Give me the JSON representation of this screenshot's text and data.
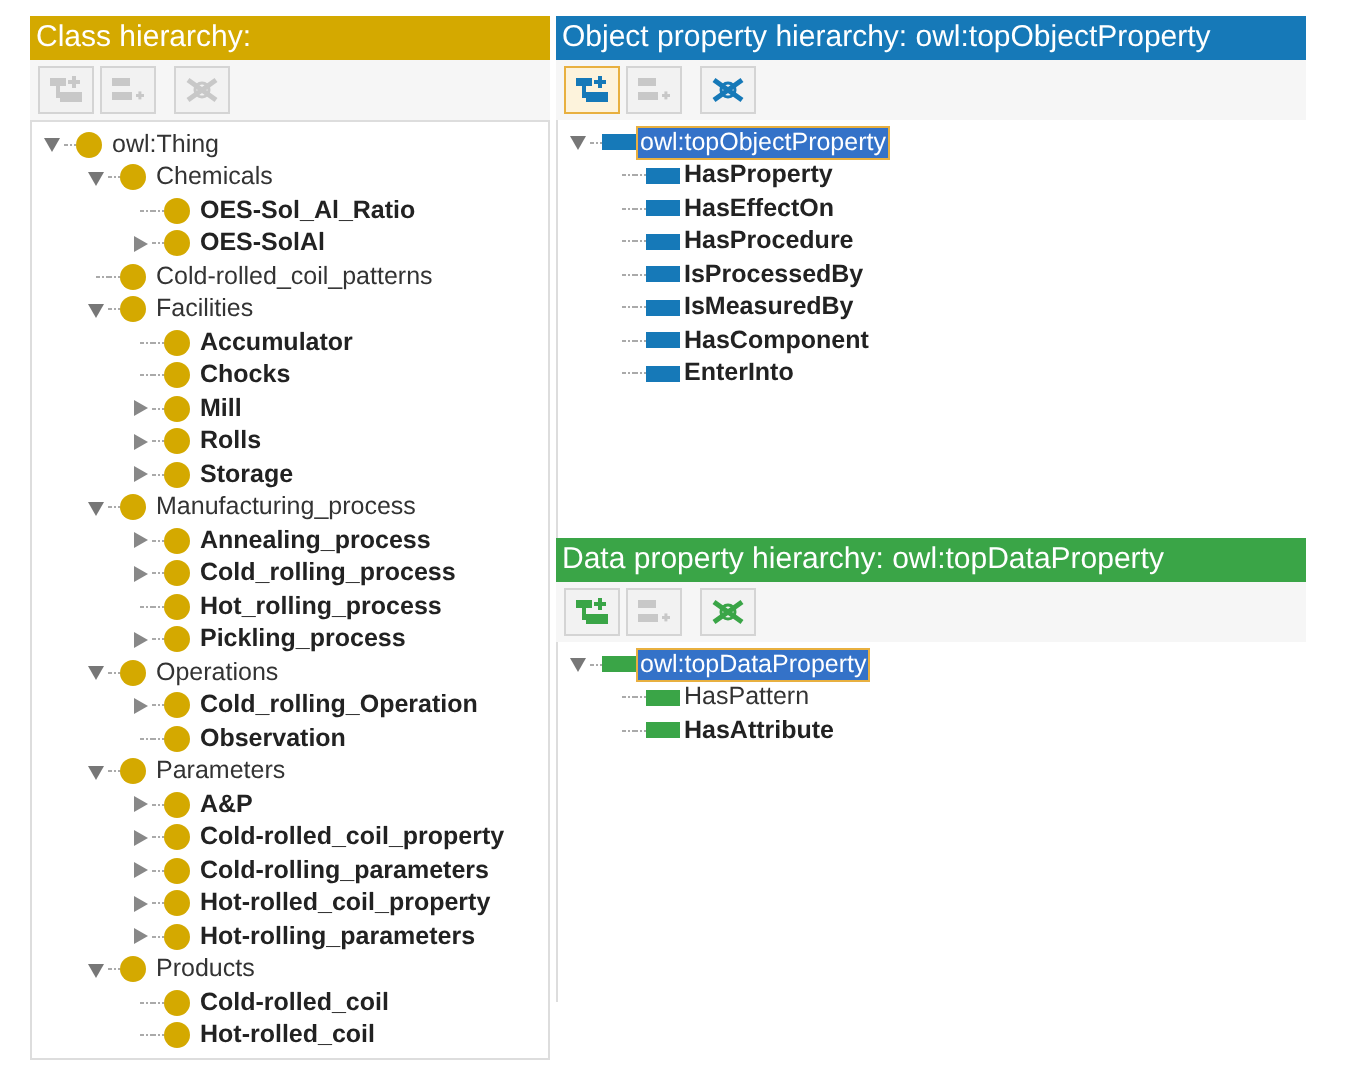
{
  "class_panel": {
    "title": "Class hierarchy:",
    "color": "#d4a900",
    "toolbar": [
      {
        "kind": "add-sub",
        "disabled": true,
        "selected": false
      },
      {
        "kind": "add-sibling",
        "disabled": true,
        "selected": false
      },
      {
        "kind": "delete",
        "disabled": true,
        "selected": false
      }
    ],
    "tree": [
      {
        "label": "owl:Thing",
        "bold": false,
        "selected": false,
        "kind": "branch",
        "expanded": true,
        "children": [
          {
            "label": "Chemicals",
            "bold": false,
            "selected": false,
            "kind": "branch",
            "expanded": true,
            "children": [
              {
                "label": "OES-Sol_Al_Ratio",
                "bold": true,
                "selected": false,
                "kind": "leaf"
              },
              {
                "label": "OES-SolAl",
                "bold": true,
                "selected": false,
                "kind": "branch",
                "expanded": false
              }
            ]
          },
          {
            "label": "Cold-rolled_coil_patterns",
            "bold": false,
            "selected": false,
            "kind": "leaf"
          },
          {
            "label": "Facilities",
            "bold": false,
            "selected": false,
            "kind": "branch",
            "expanded": true,
            "children": [
              {
                "label": "Accumulator",
                "bold": true,
                "selected": false,
                "kind": "leaf"
              },
              {
                "label": "Chocks",
                "bold": true,
                "selected": false,
                "kind": "leaf"
              },
              {
                "label": "Mill",
                "bold": true,
                "selected": false,
                "kind": "branch",
                "expanded": false
              },
              {
                "label": "Rolls",
                "bold": true,
                "selected": false,
                "kind": "branch",
                "expanded": false
              },
              {
                "label": "Storage",
                "bold": true,
                "selected": false,
                "kind": "branch",
                "expanded": false
              }
            ]
          },
          {
            "label": "Manufacturing_process",
            "bold": false,
            "selected": false,
            "kind": "branch",
            "expanded": true,
            "children": [
              {
                "label": "Annealing_process",
                "bold": true,
                "selected": false,
                "kind": "branch",
                "expanded": false
              },
              {
                "label": "Cold_rolling_process",
                "bold": true,
                "selected": false,
                "kind": "branch",
                "expanded": false
              },
              {
                "label": "Hot_rolling_process",
                "bold": true,
                "selected": false,
                "kind": "leaf"
              },
              {
                "label": "Pickling_process",
                "bold": true,
                "selected": false,
                "kind": "branch",
                "expanded": false
              }
            ]
          },
          {
            "label": "Operations",
            "bold": false,
            "selected": false,
            "kind": "branch",
            "expanded": true,
            "children": [
              {
                "label": "Cold_rolling_Operation",
                "bold": true,
                "selected": false,
                "kind": "branch",
                "expanded": false
              },
              {
                "label": "Observation",
                "bold": true,
                "selected": false,
                "kind": "leaf"
              }
            ]
          },
          {
            "label": "Parameters",
            "bold": false,
            "selected": false,
            "kind": "branch",
            "expanded": true,
            "children": [
              {
                "label": "A&P",
                "bold": true,
                "selected": false,
                "kind": "branch",
                "expanded": false
              },
              {
                "label": "Cold-rolled_coil_property",
                "bold": true,
                "selected": false,
                "kind": "branch",
                "expanded": false
              },
              {
                "label": "Cold-rolling_parameters",
                "bold": true,
                "selected": false,
                "kind": "branch",
                "expanded": false
              },
              {
                "label": "Hot-rolled_coil_property",
                "bold": true,
                "selected": false,
                "kind": "branch",
                "expanded": false
              },
              {
                "label": "Hot-rolling_parameters",
                "bold": true,
                "selected": false,
                "kind": "branch",
                "expanded": false
              }
            ]
          },
          {
            "label": "Products",
            "bold": false,
            "selected": false,
            "kind": "branch",
            "expanded": true,
            "children": [
              {
                "label": "Cold-rolled_coil",
                "bold": true,
                "selected": false,
                "kind": "leaf"
              },
              {
                "label": "Hot-rolled_coil",
                "bold": true,
                "selected": false,
                "kind": "leaf"
              }
            ]
          }
        ]
      }
    ]
  },
  "object_panel": {
    "title": "Object property hierarchy: owl:topObjectProperty",
    "color": "#1679b8",
    "toolbar": [
      {
        "kind": "add-sub",
        "disabled": false,
        "selected": true
      },
      {
        "kind": "add-sibling",
        "disabled": true,
        "selected": false
      },
      {
        "kind": "delete",
        "disabled": false,
        "selected": false
      }
    ],
    "tree": [
      {
        "label": "owl:topObjectProperty",
        "bold": false,
        "selected": true,
        "kind": "branch",
        "expanded": true,
        "children": [
          {
            "label": "HasProperty",
            "bold": true,
            "selected": false,
            "kind": "leaf"
          },
          {
            "label": "HasEffectOn",
            "bold": true,
            "selected": false,
            "kind": "leaf"
          },
          {
            "label": "HasProcedure",
            "bold": true,
            "selected": false,
            "kind": "leaf"
          },
          {
            "label": "IsProcessedBy",
            "bold": true,
            "selected": false,
            "kind": "leaf"
          },
          {
            "label": "IsMeasuredBy",
            "bold": true,
            "selected": false,
            "kind": "leaf"
          },
          {
            "label": "HasComponent",
            "bold": true,
            "selected": false,
            "kind": "leaf"
          },
          {
            "label": "EnterInto",
            "bold": true,
            "selected": false,
            "kind": "leaf"
          }
        ]
      }
    ]
  },
  "data_panel": {
    "title": "Data property hierarchy: owl:topDataProperty",
    "color": "#3aa547",
    "toolbar": [
      {
        "kind": "add-sub",
        "disabled": false,
        "selected": false
      },
      {
        "kind": "add-sibling",
        "disabled": true,
        "selected": false
      },
      {
        "kind": "delete",
        "disabled": false,
        "selected": false
      }
    ],
    "tree": [
      {
        "label": "owl:topDataProperty",
        "bold": false,
        "selected": true,
        "kind": "branch",
        "expanded": true,
        "children": [
          {
            "label": "HasPattern",
            "bold": false,
            "selected": false,
            "kind": "leaf"
          },
          {
            "label": "HasAttribute",
            "bold": true,
            "selected": false,
            "kind": "leaf"
          }
        ]
      }
    ]
  }
}
